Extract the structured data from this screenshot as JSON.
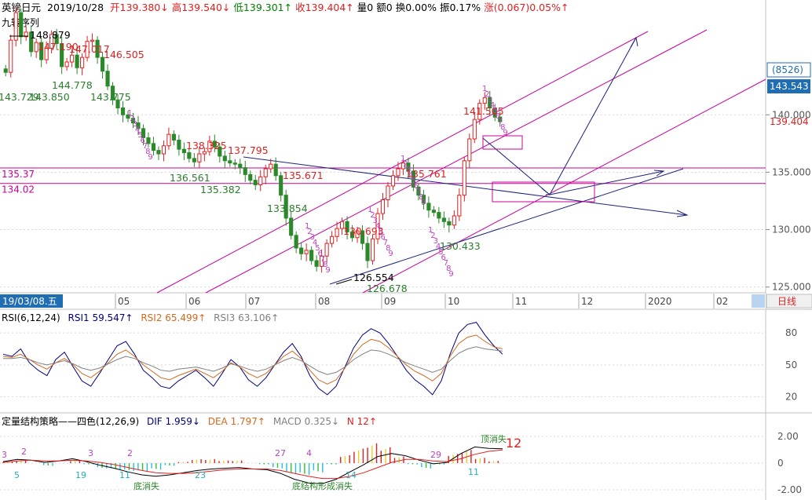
{
  "header": {
    "symbol": "英镑日元",
    "date": "2019/10/28",
    "fields": [
      {
        "label": "开",
        "value": "139.380↓",
        "color": "#e02020"
      },
      {
        "label": "高",
        "value": "139.540↓",
        "color": "#e02020"
      },
      {
        "label": "低",
        "value": "139.301↑",
        "color": "#008000"
      },
      {
        "label": "收",
        "value": "139.404↑",
        "color": "#e02020"
      },
      {
        "label": "量",
        "value": "0",
        "color": "#000000"
      },
      {
        "label": "额",
        "value": "0",
        "color": "#000000"
      },
      {
        "label": "换",
        "value": "0.00%",
        "color": "#000000"
      },
      {
        "label": "振",
        "value": "0.17%",
        "color": "#000000"
      },
      {
        "label": "涨",
        "value": "(0.067)0.05%↑",
        "color": "#e02020"
      }
    ],
    "indicator": "九转序列"
  },
  "right_axis": {
    "price_ticks": [
      "140.000",
      "135.000",
      "130.000",
      "125.000"
    ],
    "count_label": "(8526)",
    "price_marker": "143.543",
    "last_price": "139.404",
    "period_label": "日线"
  },
  "time_axis": {
    "cursor_date": "19/03/08.五",
    "months": [
      "05",
      "06",
      "07",
      "08",
      "09",
      "10",
      "11",
      "12",
      "2020",
      "02"
    ]
  },
  "price_labels": [
    {
      "text": "148.879",
      "color": "#000000"
    },
    {
      "text": "147.190",
      "color": "#e02020"
    },
    {
      "text": "147.017",
      "color": "#e02020"
    },
    {
      "text": "146.505",
      "color": "#e02020"
    },
    {
      "text": "143.729",
      "color": "#2a7d2a"
    },
    {
      "text": "143.850",
      "color": "#2a7d2a"
    },
    {
      "text": "144.778",
      "color": "#2a7d2a"
    },
    {
      "text": "143.775",
      "color": "#2a7d2a"
    },
    {
      "text": "138.325",
      "color": "#e02020"
    },
    {
      "text": "137.795",
      "color": "#e02020"
    },
    {
      "text": "136.561",
      "color": "#2a7d2a"
    },
    {
      "text": "135.382",
      "color": "#2a7d2a"
    },
    {
      "text": "135.671",
      "color": "#e02020"
    },
    {
      "text": "133.854",
      "color": "#2a7d2a"
    },
    {
      "text": "130.693",
      "color": "#e02020"
    },
    {
      "text": "126.554",
      "color": "#000000"
    },
    {
      "text": "126.678",
      "color": "#2a7d2a"
    },
    {
      "text": "135.761",
      "color": "#e02020"
    },
    {
      "text": "130.433",
      "color": "#2a7d2a"
    },
    {
      "text": "141.505",
      "color": "#e02020"
    }
  ],
  "level_labels": [
    "135.37",
    "134.02"
  ],
  "nine_turn_digits": [
    "1",
    "2",
    "3",
    "4",
    "5",
    "6",
    "7",
    "8",
    "9"
  ],
  "rsi_panel": {
    "title": "RSI(6,12,24)",
    "rsi1": "RSI1 59.547↑",
    "rsi2": "RSI2 65.499↑",
    "rsi3": "RSI3 63.106↑",
    "ticks": [
      "80",
      "50",
      "20"
    ],
    "colors": {
      "rsi1": "#000080",
      "rsi2": "#d2691e",
      "rsi3": "#808080"
    }
  },
  "macd_panel": {
    "title": "定量结构策略——四色(12,26,9)",
    "dif": "DIF 1.959↓",
    "dea": "DEA 1.797↑",
    "macd": "MACD 0.325↓",
    "n": "N 12↑",
    "ticks": [
      "2.00",
      "0",
      "-2.00"
    ],
    "counts": [
      "3",
      "2",
      "3",
      "2",
      "27",
      "4",
      "29",
      "12",
      "5",
      "19",
      "11",
      "23",
      "14",
      "11"
    ],
    "notes": [
      "底消失",
      "底结构形成消失",
      "顶消失"
    ]
  },
  "chart_data": [
    {
      "type": "candlestick",
      "title": "英镑日元 日线",
      "ylim": [
        124.5,
        150
      ],
      "yticks": [
        125,
        130,
        135,
        140
      ],
      "x_months": [
        "05",
        "06",
        "07",
        "08",
        "09",
        "10",
        "11",
        "12",
        "2020",
        "02"
      ],
      "candles_approx_close": [
        143.7,
        146.5,
        148.9,
        146.8,
        147.2,
        145.5,
        146.3,
        144.8,
        145.8,
        147.0,
        146.2,
        144.2,
        144.6,
        145.2,
        144.1,
        145.0,
        146.4,
        146.5,
        145.0,
        143.8,
        142.5,
        141.3,
        140.6,
        140.0,
        139.7,
        139.3,
        138.8,
        138.0,
        137.5,
        136.9,
        136.6,
        137.3,
        138.3,
        137.8,
        137.0,
        136.7,
        136.2,
        135.9,
        136.6,
        136.8,
        137.7,
        137.2,
        136.4,
        136.0,
        135.8,
        135.7,
        135.4,
        134.8,
        134.3,
        133.9,
        134.6,
        135.3,
        135.7,
        134.7,
        133.0,
        131.0,
        129.5,
        128.4,
        127.9,
        128.2,
        127.3,
        126.8,
        127.7,
        128.8,
        129.4,
        130.1,
        130.7,
        129.8,
        129.3,
        129.9,
        128.8,
        127.3,
        129.2,
        131.4,
        132.6,
        133.8,
        134.7,
        135.3,
        135.8,
        135.1,
        133.7,
        133.0,
        132.3,
        131.7,
        131.5,
        131.0,
        130.7,
        130.4,
        131.2,
        133.0,
        136.0,
        137.9,
        139.6,
        141.0,
        141.5,
        140.6,
        139.8,
        139.4
      ],
      "ma_levels": [
        135.37,
        134.02
      ],
      "annotations": [
        "148.879",
        "147.190",
        "147.017",
        "146.505",
        "143.729",
        "143.850",
        "144.778",
        "143.775",
        "138.325",
        "137.795",
        "136.561",
        "135.382",
        "135.671",
        "133.854",
        "130.693",
        "126.554",
        "126.678",
        "135.761",
        "130.433",
        "141.505"
      ]
    },
    {
      "type": "line",
      "title": "RSI(6,12,24)",
      "ylim": [
        5,
        100
      ],
      "yticks": [
        20,
        50,
        80
      ],
      "series": [
        {
          "name": "RSI1",
          "values": [
            60,
            58,
            65,
            52,
            45,
            40,
            55,
            62,
            48,
            35,
            30,
            42,
            55,
            68,
            72,
            60,
            45,
            38,
            30,
            28,
            35,
            40,
            45,
            38,
            30,
            42,
            55,
            48,
            36,
            30,
            38,
            50,
            62,
            70,
            58,
            40,
            28,
            22,
            30,
            48,
            66,
            78,
            84,
            80,
            70,
            58,
            45,
            36,
            30,
            22,
            35,
            60,
            80,
            88,
            90,
            78,
            68,
            60
          ]
        },
        {
          "name": "RSI2",
          "values": [
            58,
            57,
            60,
            55,
            50,
            46,
            52,
            56,
            50,
            42,
            38,
            44,
            52,
            60,
            64,
            58,
            50,
            44,
            38,
            36,
            40,
            43,
            46,
            42,
            38,
            44,
            52,
            48,
            42,
            38,
            42,
            50,
            58,
            63,
            56,
            45,
            36,
            32,
            36,
            47,
            60,
            69,
            74,
            72,
            66,
            58,
            50,
            44,
            40,
            35,
            42,
            58,
            70,
            76,
            78,
            72,
            67,
            65
          ]
        },
        {
          "name": "RSI3",
          "values": [
            56,
            56,
            57,
            55,
            52,
            50,
            52,
            54,
            51,
            47,
            45,
            47,
            51,
            55,
            58,
            56,
            52,
            49,
            45,
            44,
            46,
            47,
            48,
            46,
            44,
            47,
            51,
            49,
            46,
            44,
            46,
            50,
            54,
            57,
            54,
            49,
            44,
            41,
            43,
            48,
            55,
            60,
            64,
            63,
            60,
            56,
            52,
            49,
            46,
            43,
            46,
            54,
            61,
            65,
            67,
            65,
            64,
            63
          ]
        }
      ]
    },
    {
      "type": "bar",
      "title": "定量结构策略——四色(12,26,9)",
      "ylim": [
        -3,
        3
      ],
      "yticks": [
        -2,
        0,
        2
      ],
      "series": [
        {
          "name": "DIF",
          "values": [
            0.2,
            0.5,
            0.4,
            0.1,
            0.3,
            0.6,
            0.2,
            -0.3,
            -0.7,
            -1.2,
            -1.6,
            -1.8,
            -1.6,
            -1.3,
            -1.0,
            -0.8,
            -0.7,
            -0.6,
            -0.8,
            -0.9,
            -1.4,
            -2.2,
            -2.7,
            -2.8,
            -2.2,
            -1.2,
            -0.2,
            0.9,
            1.3,
            1.0,
            0.4,
            -0.1,
            0.1,
            1.3,
            2.2,
            2.0,
            1.96
          ]
        },
        {
          "name": "DEA",
          "values": [
            0.1,
            0.3,
            0.4,
            0.3,
            0.3,
            0.4,
            0.3,
            0.1,
            -0.2,
            -0.6,
            -1.0,
            -1.3,
            -1.4,
            -1.4,
            -1.3,
            -1.1,
            -0.9,
            -0.8,
            -0.8,
            -0.8,
            -1.0,
            -1.4,
            -1.8,
            -2.1,
            -2.1,
            -1.8,
            -1.3,
            -0.6,
            0.1,
            0.5,
            0.5,
            0.3,
            0.2,
            0.6,
            1.2,
            1.6,
            1.8
          ]
        },
        {
          "name": "MACD",
          "values": [
            0.2,
            0.4,
            0.0,
            -0.4,
            0.0,
            0.4,
            -0.2,
            -0.8,
            -1.0,
            -1.2,
            -1.2,
            -1.0,
            -0.4,
            0.2,
            0.6,
            0.6,
            0.4,
            0.4,
            0.0,
            -0.2,
            -0.8,
            -1.6,
            -1.8,
            -1.4,
            -0.2,
            1.2,
            2.2,
            3.0,
            2.4,
            1.0,
            -0.2,
            -0.8,
            -0.2,
            1.4,
            2.0,
            0.8,
            0.33
          ]
        }
      ]
    }
  ]
}
